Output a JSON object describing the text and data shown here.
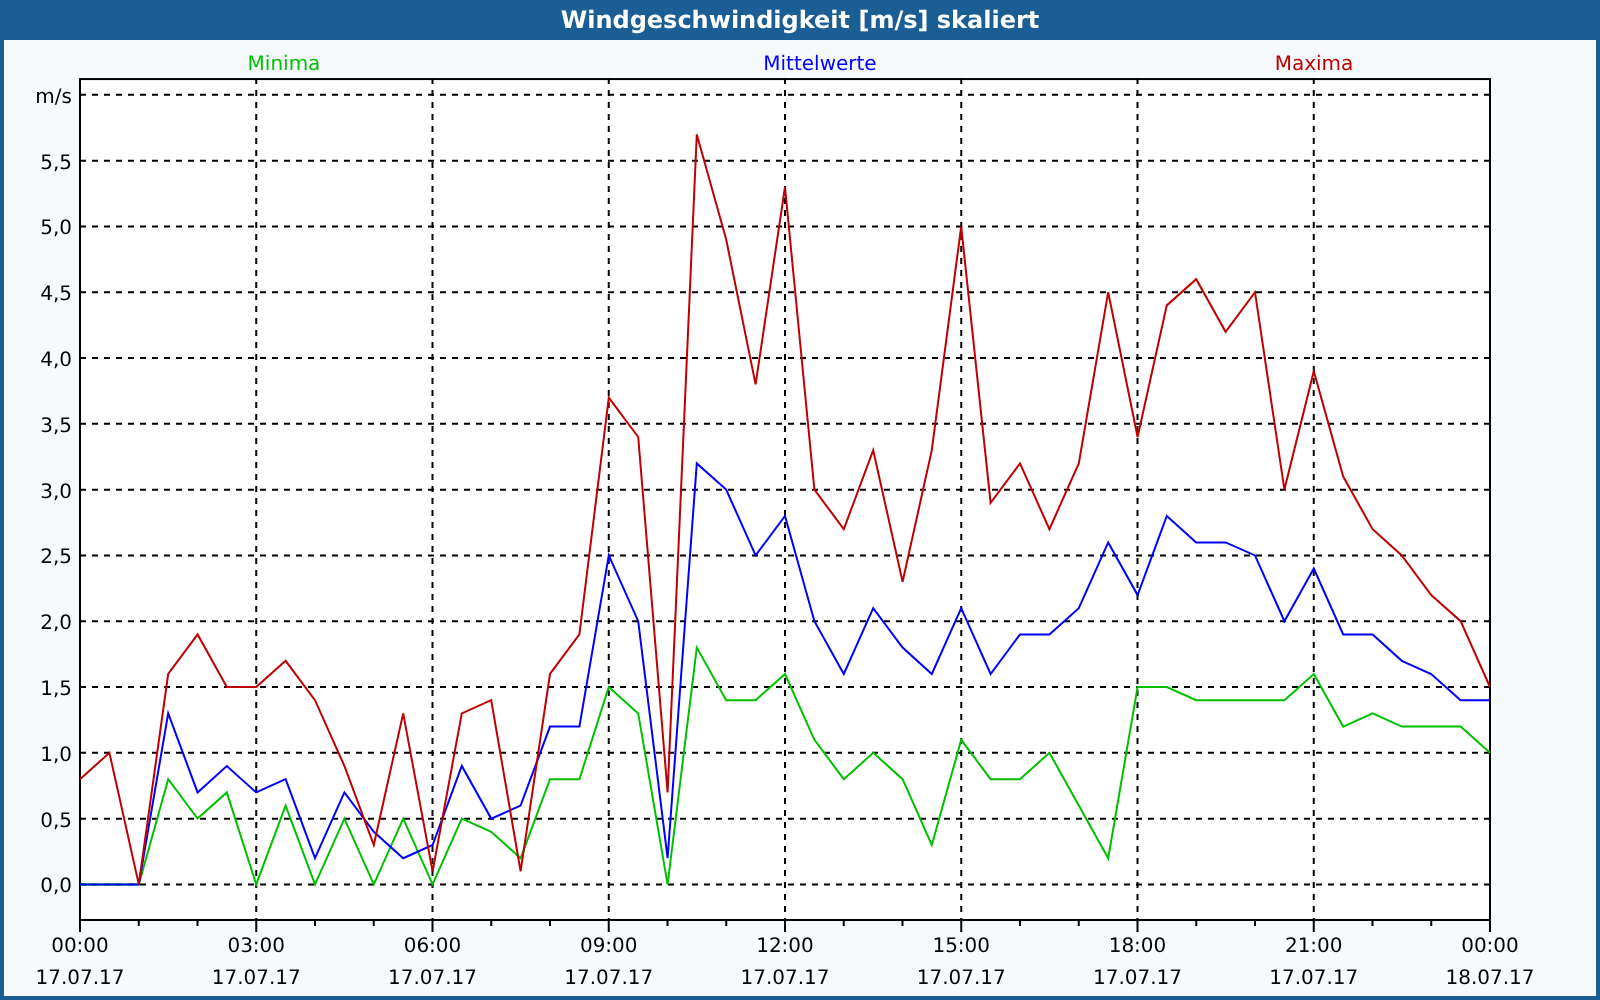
{
  "window": {
    "title": "Windgeschwindigkeit [m/s] skaliert"
  },
  "chart": {
    "chart_data": {
      "type": "line",
      "grid": true,
      "ylabel": "m/s",
      "ylim": [
        -0.27,
        6.12
      ],
      "yticks": [
        {
          "value": 0,
          "label": "0,0"
        },
        {
          "value": 0.5,
          "label": "0,5"
        },
        {
          "value": 1,
          "label": "1,0"
        },
        {
          "value": 1.5,
          "label": "1,5"
        },
        {
          "value": 2,
          "label": "2,0"
        },
        {
          "value": 2.5,
          "label": "2,5"
        },
        {
          "value": 3,
          "label": "3,0"
        },
        {
          "value": 3.5,
          "label": "3,5"
        },
        {
          "value": 4,
          "label": "4,0"
        },
        {
          "value": 4.5,
          "label": "4,5"
        },
        {
          "value": 5,
          "label": "5,0"
        },
        {
          "value": 5.5,
          "label": "5,5"
        }
      ],
      "categories": [
        "00:00 17.07.17",
        null,
        null,
        null,
        null,
        null,
        "03:00 17.07.17",
        null,
        null,
        null,
        null,
        null,
        "06:00 17.07.17",
        null,
        null,
        null,
        null,
        null,
        "09:00 17.07.17",
        null,
        null,
        null,
        null,
        null,
        "12:00 17.07.17",
        null,
        null,
        null,
        null,
        null,
        "15:00 17.07.17",
        null,
        null,
        null,
        null,
        null,
        "18:00 17.07.17",
        null,
        null,
        null,
        null,
        null,
        "21:00 17.07.17",
        null,
        null,
        null,
        null,
        null,
        "00:00 18.07.17"
      ],
      "series": [
        {
          "name": "Minima",
          "color": "#00c000",
          "values": [
            0,
            0,
            0,
            0.8,
            0.5,
            0.7,
            0,
            0.6,
            0,
            0.5,
            0,
            0.5,
            0,
            0.5,
            0.4,
            0.2,
            0.8,
            0.8,
            1.5,
            1.3,
            0,
            1.8,
            1.4,
            1.4,
            1.6,
            1.1,
            0.8,
            1,
            0.8,
            0.3,
            1.1,
            0.8,
            0.8,
            1,
            0.6,
            0.2,
            1.5,
            1.5,
            1.4,
            1.4,
            1.4,
            1.4,
            1.6,
            1.2,
            1.3,
            1.2,
            1.2,
            1.2,
            1
          ]
        },
        {
          "name": "Mittelwerte",
          "color": "#0000ff",
          "values": [
            0,
            0,
            0,
            1.3,
            0.7,
            0.9,
            0.7,
            0.8,
            0.2,
            0.7,
            0.4,
            0.2,
            0.3,
            0.9,
            0.5,
            0.6,
            1.2,
            1.2,
            2.5,
            2,
            0.2,
            3.2,
            3,
            2.5,
            2.8,
            2,
            1.6,
            2.1,
            1.8,
            1.6,
            2.1,
            1.6,
            1.9,
            1.9,
            2.1,
            2.6,
            2.2,
            2.8,
            2.6,
            2.6,
            2.5,
            2,
            2.4,
            1.9,
            1.9,
            1.7,
            1.6,
            1.4,
            1.4
          ]
        },
        {
          "name": "Maxima",
          "color": "#c00000",
          "values": [
            0.8,
            1,
            0,
            1.6,
            1.9,
            1.5,
            1.5,
            1.7,
            1.4,
            0.9,
            0.3,
            1.3,
            0.1,
            1.3,
            1.4,
            0.1,
            1.6,
            1.9,
            3.7,
            3.4,
            0.7,
            5.7,
            4.9,
            3.8,
            5.3,
            3,
            2.7,
            3.3,
            2.3,
            3.3,
            5,
            2.9,
            3.2,
            2.7,
            3.2,
            4.5,
            3.4,
            4.4,
            4.6,
            4.2,
            4.5,
            3,
            3.9,
            3.1,
            2.7,
            2.5,
            2.2,
            2,
            1.5
          ]
        }
      ]
    }
  }
}
